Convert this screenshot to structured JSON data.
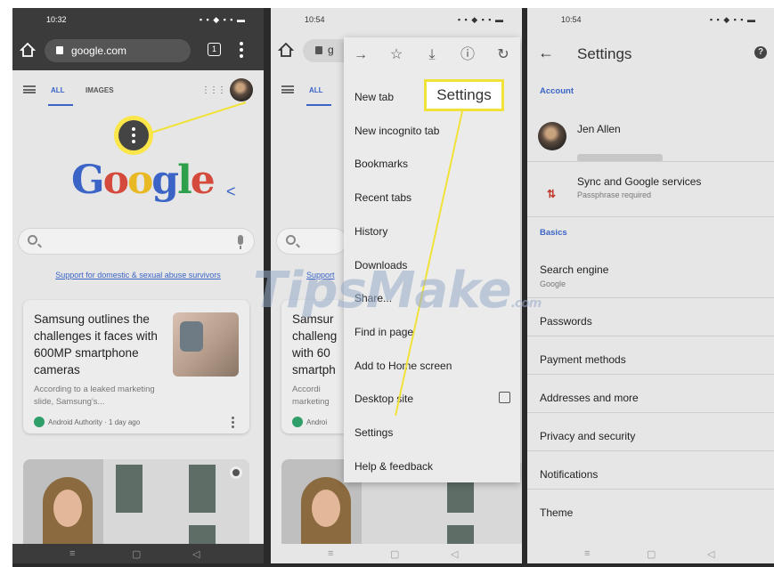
{
  "left_screen": {
    "status_time": "10:32",
    "url": "google.com",
    "tab_count": "1",
    "tabs": {
      "all": "ALL",
      "images": "IMAGES"
    },
    "logo_letters": [
      {
        "ch": "G",
        "color": "#3b64c6"
      },
      {
        "ch": "o",
        "color": "#d44b3d"
      },
      {
        "ch": "o",
        "color": "#e8b825"
      },
      {
        "ch": "g",
        "color": "#3b64c6"
      },
      {
        "ch": "l",
        "color": "#2e9f4a"
      },
      {
        "ch": "e",
        "color": "#d44b3d"
      }
    ],
    "support_link": "Support for domestic & sexual abuse survivors",
    "card": {
      "title": "Samsung outlines the challenges it faces with 600MP smartphone cameras",
      "snippet": "According to a leaked marketing slide, Samsung's...",
      "source": "Android Authority · 1 day ago"
    }
  },
  "middle_screen": {
    "status_time": "10:54",
    "url_fragment": "g",
    "menu_items": [
      {
        "label": "New tab"
      },
      {
        "label": "New incognito tab"
      },
      {
        "label": "Bookmarks"
      },
      {
        "label": "Recent tabs"
      },
      {
        "label": "History"
      },
      {
        "label": "Downloads"
      },
      {
        "label": "Share..."
      },
      {
        "label": "Find in page"
      },
      {
        "label": "Add to Home screen"
      },
      {
        "label": "Desktop site",
        "checkbox": true
      },
      {
        "label": "Settings"
      },
      {
        "label": "Help & feedback"
      }
    ],
    "callout": "Settings",
    "behind_text": {
      "all": "ALL",
      "support": "Support",
      "card_lines": [
        "Samsur",
        "challeng",
        "with 60",
        "smartph"
      ],
      "snippet": [
        "Accordi",
        "marketing"
      ],
      "source": "Androi"
    }
  },
  "right_screen": {
    "status_time": "10:54",
    "title": "Settings",
    "sections": {
      "account": "Account",
      "basics": "Basics"
    },
    "account_name": "Jen Allen",
    "sync": {
      "title": "Sync and Google services",
      "subtitle": "Passphrase required"
    },
    "search_engine": {
      "title": "Search engine",
      "subtitle": "Google"
    },
    "basics_items": [
      "Passwords",
      "Payment methods",
      "Addresses and more",
      "Privacy and security",
      "Notifications",
      "Theme"
    ]
  },
  "watermark": {
    "main": "TipsMake",
    "suffix": ".com"
  },
  "colors": {
    "highlight": "#f1e23a",
    "link_blue": "#3b64c6"
  }
}
